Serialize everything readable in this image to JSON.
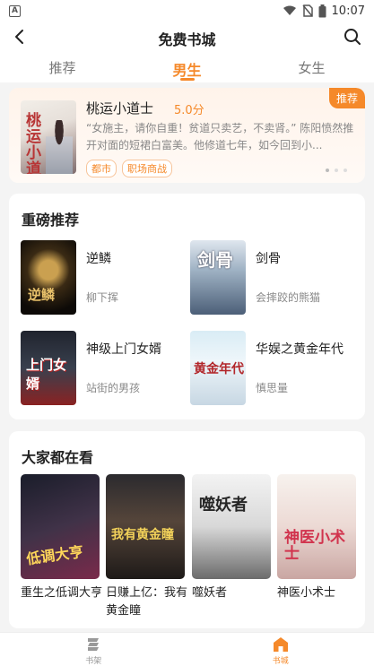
{
  "status_bar": {
    "time": "10:07"
  },
  "header": {
    "title": "免费书城"
  },
  "tabs": [
    {
      "label": "推荐",
      "active": false
    },
    {
      "label": "男生",
      "active": true
    },
    {
      "label": "女生",
      "active": false
    }
  ],
  "banner": {
    "badge": "推荐",
    "cover_title": "桃运小道士",
    "book_title": "桃运小道士",
    "score": "5.0分",
    "description": "“女施主，请你自重！贫道只卖艺，不卖肾。” 陈阳愤然推开对面的短裙白富美。他修道七年，如今回到小...",
    "tags": [
      "都市",
      "职场商战"
    ],
    "pager": {
      "total": 3,
      "active": 1
    }
  },
  "featured": {
    "title": "重磅推荐",
    "books": [
      {
        "cover_text": "逆鳞",
        "title": "逆鳞",
        "author": "柳下挥"
      },
      {
        "cover_text": "剑骨",
        "title": "剑骨",
        "author": "会摔跤的熊猫"
      },
      {
        "cover_text": "上门女婿",
        "title": "神级上门女婿",
        "author": "站街的男孩"
      },
      {
        "cover_text": "黄金年代",
        "title": "华娱之黄金年代",
        "author": "慎思量"
      }
    ]
  },
  "everyone": {
    "title": "大家都在看",
    "books": [
      {
        "cover_text": "低调大亨",
        "title": "重生之低调大亨"
      },
      {
        "cover_text": "我有黄金瞳",
        "title": "日赚上亿：我有黄金瞳"
      },
      {
        "cover_text": "噬妖者",
        "title": "噬妖者"
      },
      {
        "cover_text": "神医小术士",
        "title": "神医小术士"
      }
    ]
  },
  "bottom_nav": [
    {
      "label": "书架",
      "icon": "bookshelf-icon",
      "active": false
    },
    {
      "label": "书城",
      "icon": "bookstore-home-icon",
      "active": true
    }
  ],
  "colors": {
    "accent": "#f5892a",
    "text": "#222222",
    "muted": "#888888",
    "background": "#f4f4f4"
  }
}
